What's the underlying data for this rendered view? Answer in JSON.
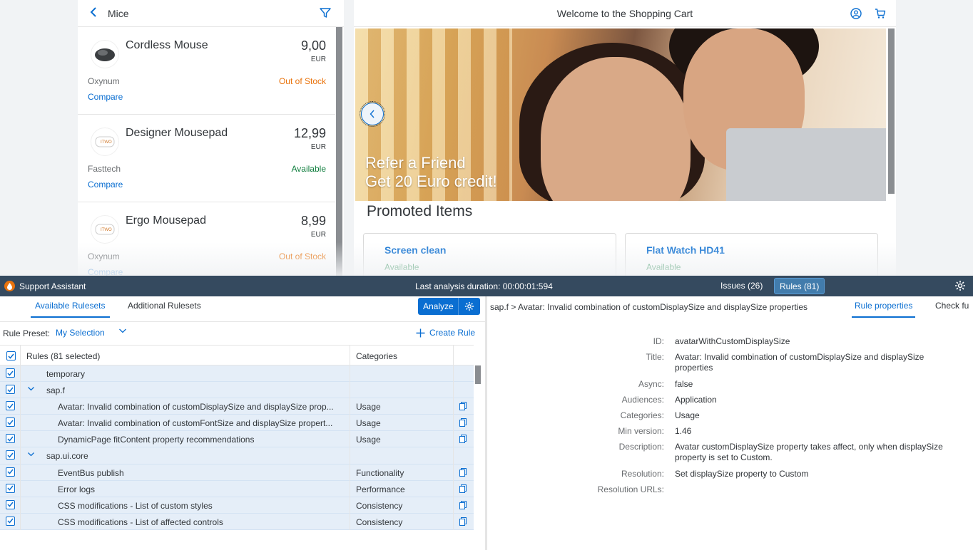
{
  "master": {
    "title": "Mice",
    "products": [
      {
        "name": "Cordless Mouse",
        "price": "9,00",
        "currency": "EUR",
        "supplier": "Oxynum",
        "status": "Out of Stock",
        "status_type": "oos",
        "compare": "Compare"
      },
      {
        "name": "Designer Mousepad",
        "price": "12,99",
        "currency": "EUR",
        "supplier": "Fasttech",
        "status": "Available",
        "status_type": "avail",
        "compare": "Compare"
      },
      {
        "name": "Ergo Mousepad",
        "price": "8,99",
        "currency": "EUR",
        "supplier": "Oxynum",
        "status": "Out of Stock",
        "status_type": "oos",
        "compare": "Compare"
      }
    ]
  },
  "detail": {
    "title": "Welcome to the Shopping Cart",
    "promo_line1": "Refer a Friend",
    "promo_line2": "Get 20 Euro credit!",
    "promoted_title": "Promoted Items",
    "cards": [
      {
        "title": "Screen clean",
        "status": "Available"
      },
      {
        "title": "Flat Watch HD41",
        "status": "Available"
      }
    ]
  },
  "support_assistant": {
    "title": "Support Assistant",
    "duration": "Last analysis duration: 00:00:01:594",
    "issues_tab": "Issues (26)",
    "rules_tab": "Rules (81)",
    "left": {
      "tabs": [
        "Available Rulesets",
        "Additional Rulesets"
      ],
      "analyze_label": "Analyze",
      "preset_label": "Rule Preset:",
      "preset_value": "My Selection",
      "create_rule": "Create Rule",
      "col_rules": "Rules (81 selected)",
      "col_categories": "Categories",
      "rows": [
        {
          "name": "temporary",
          "category": "",
          "level": 0,
          "toggle": ""
        },
        {
          "name": "sap.f",
          "category": "",
          "level": 0,
          "toggle": "v"
        },
        {
          "name": "Avatar: Invalid combination of customDisplaySize and displaySize prop...",
          "category": "Usage",
          "level": 1,
          "toggle": ""
        },
        {
          "name": "Avatar: Invalid combination of customFontSize and displaySize propert...",
          "category": "Usage",
          "level": 1,
          "toggle": ""
        },
        {
          "name": "DynamicPage fitContent property recommendations",
          "category": "Usage",
          "level": 1,
          "toggle": ""
        },
        {
          "name": "sap.ui.core",
          "category": "",
          "level": 0,
          "toggle": "v"
        },
        {
          "name": "EventBus publish",
          "category": "Functionality",
          "level": 1,
          "toggle": ""
        },
        {
          "name": "Error logs",
          "category": "Performance",
          "level": 1,
          "toggle": ""
        },
        {
          "name": "CSS modifications - List of custom styles",
          "category": "Consistency",
          "level": 1,
          "toggle": ""
        },
        {
          "name": "CSS modifications - List of affected controls",
          "category": "Consistency",
          "level": 1,
          "toggle": ""
        }
      ]
    },
    "right": {
      "breadcrumb": "sap.f > Avatar: Invalid combination of customDisplaySize and displaySize properties",
      "tab_properties": "Rule properties",
      "tab_check": "Check fu",
      "properties": [
        {
          "key": "ID:",
          "value": "avatarWithCustomDisplaySize"
        },
        {
          "key": "Title:",
          "value": "Avatar: Invalid combination of customDisplaySize and displaySize properties"
        },
        {
          "key": "Async:",
          "value": "false"
        },
        {
          "key": "Audiences:",
          "value": "Application"
        },
        {
          "key": "Categories:",
          "value": "Usage"
        },
        {
          "key": "Min version:",
          "value": "1.46"
        },
        {
          "key": "Description:",
          "value": "Avatar customDisplaySize property takes affect, only when displaySize property is set to Custom."
        },
        {
          "key": "Resolution:",
          "value": "Set displaySize property to Custom"
        },
        {
          "key": "Resolution URLs:",
          "value": ""
        }
      ]
    }
  }
}
